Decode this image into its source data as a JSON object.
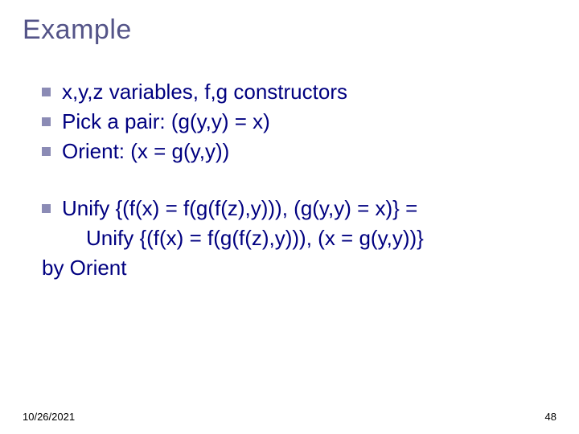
{
  "title": "Example",
  "group1": [
    "x,y,z variables, f,g constructors",
    "Pick a pair: (g(y,y) = x)",
    "Orient: (x = g(y,y))"
  ],
  "group2": {
    "line1": "Unify {(f(x) = f(g(f(z),y))), (g(y,y) = x)} =",
    "line2": "Unify {(f(x) = f(g(f(z),y))), (x = g(y,y))}"
  },
  "byline": "by Orient",
  "footer": {
    "date": "10/26/2021",
    "page": "48"
  }
}
